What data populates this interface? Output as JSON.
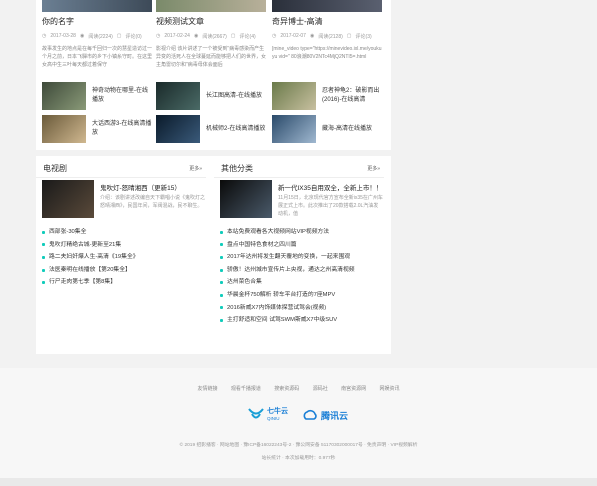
{
  "top": {
    "featured": [
      {
        "title": "你的名字",
        "date": "2017-03-28",
        "views": "阅读(2224)",
        "comments": "评论(0)",
        "desc": "故事发生的地点是在每千回归一次的慧星造访过一个月之前，日本飞驒市的乡下小镇糸守町。在这里女高中生三叶每天都过着保守"
      },
      {
        "title": "视频测试文章",
        "date": "2017-02-24",
        "views": "阅读(2667)",
        "comments": "评论(4)",
        "desc": "影视介绍 该片讲述了一个被受到\"病毒感染而产生异变的活死人在全球蔓延而能够把人们的世界，女主角雷切尔和\"病毒母体会面后"
      },
      {
        "title": "奇异博士-高清",
        "date": "2017-02-07",
        "views": "阅读(2128)",
        "comments": "评论(3)",
        "desc": "[mine_video type=\"https://minevideo.ixl.me/youkuyu vid=\" 80浪潮80V2NTc4MjQ2NTI5=.html"
      }
    ],
    "minis": [
      {
        "title": "神奇动物在哪里-在线播放"
      },
      {
        "title": "长江图高清-在线播放"
      },
      {
        "title": "忍者神龟2：破影而出(2016)-在线高清"
      },
      {
        "title": "大话西游3-在线高清播放"
      },
      {
        "title": "机械师2-在线高清播放"
      },
      {
        "title": "藏海-高清在线播放"
      }
    ]
  },
  "left_section": {
    "heading": "电视剧",
    "more": "更多»",
    "lead_title": "鬼吹灯-怒晴湘西（更新15）",
    "lead_desc": "介绍：该剧讲述改编自天下霸唱小说《鬼吹灯之怒晴湘西》，民国年间，军阀混战，民不聊生。",
    "items": [
      "西部张-30集全",
      "鬼吹灯精绝古城-更新至21集",
      "路二夫妇奸爆人生-高清《19集全》",
      "法医秦明在线播放【第20集全】",
      "行尸走肉第七季【第8集】"
    ]
  },
  "right_section": {
    "heading": "其他分类",
    "more": "更多»",
    "lead_title": "新一代IX35自用双全，全新上市！！",
    "lead_desc": "11月15日，北京现代官方宣布全新ix35在广州车展正式上市。此次推出了20款搭载2.0L汽油发动机，值",
    "items": [
      "本站免费观看各大视频网站VIP视频方法",
      "盘点中国特色食材之四川篇",
      "2017年达州将发生翻天覆地的变换，一起来围观",
      "骄傲！达州城市宣传片上央视，通达之州高清视频",
      "达州菜色合集",
      "华晨金杯750解析 轿车平台打造的7座MPV",
      "2016新威X7内饰媒体探营试驾会(视频)",
      "主打舒适和空间 试驾SWM斯威X7中级SUV"
    ]
  },
  "footer": {
    "links": [
      "友情链接",
      "观看千播报道",
      "搜索资源码",
      "源码社",
      "南宫资源网",
      "网娱资讯"
    ],
    "logo1": "七牛云",
    "logo1_sub": "QINIU",
    "logo2": "腾讯云",
    "copyright": "© 2019 招影播客 · 网站地图 · 豫ICP备16022243号-2 · 豫公网安备 51170302000017号 · 免责声明 · VIP视频解析",
    "stats": "站长统计 · 本次加载用时：0.977秒"
  },
  "colors": {
    "accent": "#11bbaa",
    "brand_blue": "#1a7fd6"
  }
}
